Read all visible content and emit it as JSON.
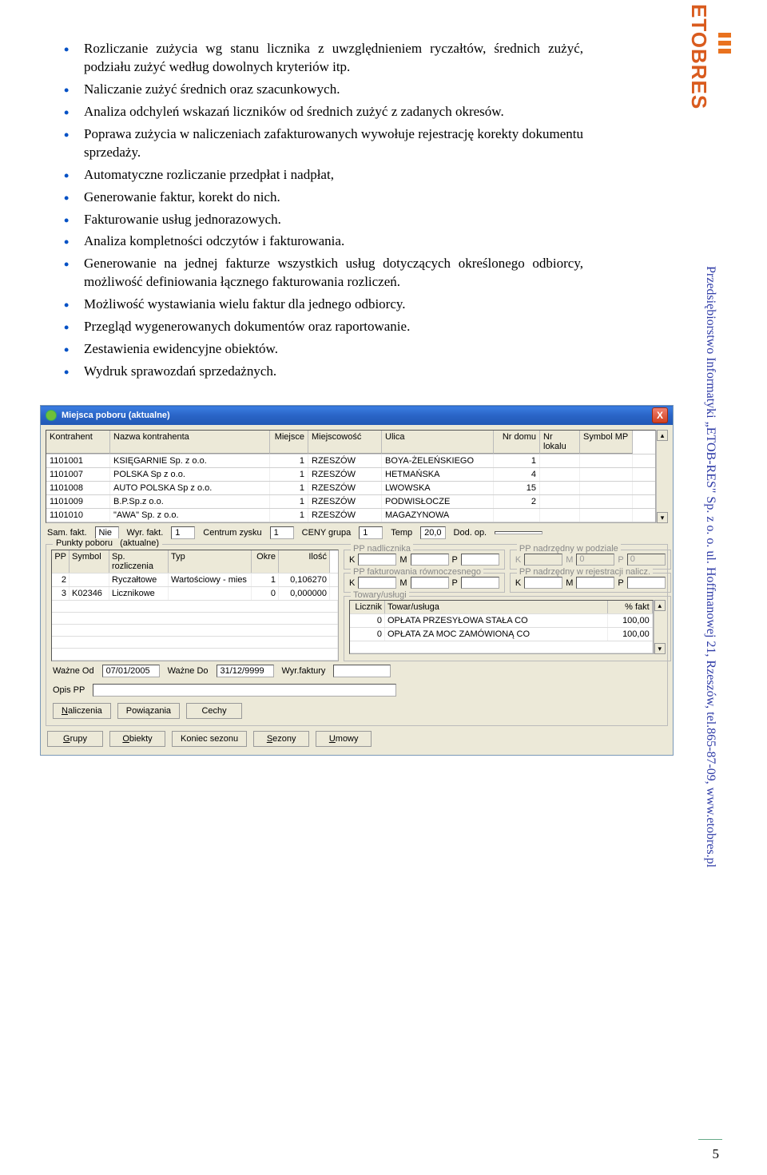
{
  "bullets": [
    "Rozliczanie zużycia wg stanu licznika z uwzględnieniem ryczałtów, średnich zużyć, podziału zużyć według dowolnych kryteriów itp.",
    "Naliczanie zużyć średnich oraz szacunkowych.",
    "Analiza odchyleń wskazań liczników od średnich zużyć z zadanych okresów.",
    "Poprawa zużycia w naliczeniach zafakturowanych wywołuje rejestrację korekty dokumentu sprzedaży.",
    "Automatyczne rozliczanie przedpłat i nadpłat,",
    "Generowanie faktur, korekt do nich.",
    "Fakturowanie usług jednorazowych.",
    "Analiza kompletności odczytów i fakturowania.",
    "Generowanie na jednej fakturze wszystkich usług dotyczących określonego odbiorcy, możliwość definiowania łącznego fakturowania rozliczeń.",
    "Możliwość wystawiania wielu faktur dla jednego odbiorcy.",
    "Przegląd wygenerowanych dokumentów oraz raportowanie.",
    "Zestawienia ewidencyjne obiektów.",
    "Wydruk sprawozdań sprzedażnych."
  ],
  "sidebar": {
    "logo": "ETOBRES",
    "text": "Przedsiębiorstwo Informatyki „ETOB-RES\" Sp. z o. o. ul. Hoffmanowej 21, Rzeszów, tel.865-87-09, www.etobres.pl"
  },
  "dialog": {
    "title": "Miejsca poboru (aktualne)",
    "close": "X",
    "grid": {
      "headers": {
        "kontrahent": "Kontrahent",
        "nazwa": "Nazwa kontrahenta",
        "miejsce": "Miejsce",
        "miejscowosc": "Miejscowość",
        "ulica": "Ulica",
        "nrdomu": "Nr domu",
        "nrlok": "Nr lokalu",
        "sym": "Symbol MP"
      },
      "rows": [
        {
          "kontrahent": "1101001",
          "nazwa": "KSIĘGARNIE Sp. z o.o.",
          "miejsce": "1",
          "miejscowosc": "RZESZÓW",
          "ulica": "BOYA-ŻELEŃSKIEGO",
          "nrdomu": "1",
          "nrlok": "",
          "sym": ""
        },
        {
          "kontrahent": "1101007",
          "nazwa": "POLSKA Sp z o.o.",
          "miejsce": "1",
          "miejscowosc": "RZESZÓW",
          "ulica": "HETMAŃSKA",
          "nrdomu": "4",
          "nrlok": "",
          "sym": ""
        },
        {
          "kontrahent": "1101008",
          "nazwa": "AUTO POLSKA Sp z o.o.",
          "miejsce": "1",
          "miejscowosc": "RZESZÓW",
          "ulica": "LWOWSKA",
          "nrdomu": "15",
          "nrlok": "",
          "sym": ""
        },
        {
          "kontrahent": "1101009",
          "nazwa": "B.P.Sp.z o.o.",
          "miejsce": "1",
          "miejscowosc": "RZESZÓW",
          "ulica": "PODWISŁOCZE",
          "nrdomu": "2",
          "nrlok": "",
          "sym": ""
        },
        {
          "kontrahent": "1101010",
          "nazwa": "\"AWA\" Sp. z o.o.",
          "miejsce": "1",
          "miejscowosc": "RZESZÓW",
          "ulica": "MAGAZYNOWA",
          "nrdomu": "",
          "nrlok": "",
          "sym": ""
        }
      ]
    },
    "info": {
      "samfakt_lbl": "Sam. fakt.",
      "samfakt_val": "Nie",
      "wyrfakt_lbl": "Wyr. fakt.",
      "wyrfakt_val": "1",
      "centrum_lbl": "Centrum zysku",
      "centrum_val": "1",
      "ceny_lbl": "CENY grupa",
      "ceny_val": "1",
      "temp_lbl": "Temp",
      "temp_val": "20,0",
      "dodop_lbl": "Dod. op.",
      "dodop_val": ""
    },
    "punkty": {
      "legend": "Punkty poboru",
      "aktualne": "(aktualne)",
      "headers": {
        "pp": "PP",
        "symbol": "Symbol",
        "sproz": "Sp. rozliczenia",
        "typ": "Typ",
        "okre": "Okre",
        "ilosc": "Ilość"
      },
      "rows": [
        {
          "pp": "2",
          "symbol": "",
          "sproz": "Ryczałtowe",
          "typ": "Wartościowy - mies",
          "okre": "1",
          "ilosc": "0,106270"
        },
        {
          "pp": "3",
          "symbol": "K02346",
          "sproz": "Licznikowe",
          "typ": "",
          "okre": "0",
          "ilosc": "0,000000"
        }
      ]
    },
    "kmp": {
      "nadlicz": "PP nadlicznika",
      "nadpodz": "PP nadrzędny w podziale",
      "faktrow": "PP fakturowania równoczesnego",
      "rejnal": "PP nadrzędny w rejestracji nalicz.",
      "K": "K",
      "M": "M",
      "P": "P",
      "zero": "0"
    },
    "towary": {
      "legend": "Towary/usługi",
      "headers": {
        "lic": "Licznik",
        "tu": "Towar/usługa",
        "fakt": "% fakt"
      },
      "rows": [
        {
          "lic": "0",
          "tu": "OPŁATA PRZESYŁOWA STAŁA CO",
          "fakt": "100,00"
        },
        {
          "lic": "0",
          "tu": "OPŁATA ZA MOC ZAMÓWIONĄ CO",
          "fakt": "100,00"
        }
      ]
    },
    "fields": {
      "wazneod_lbl": "Ważne Od",
      "wazneod_val": "07/01/2005",
      "waznedo_lbl": "Ważne Do",
      "waznedo_val": "31/12/9999",
      "wyrfakt_lbl": "Wyr.faktury",
      "wyrfakt_val": "",
      "opis_lbl": "Opis PP",
      "opis_val": ""
    },
    "buttons1": {
      "naliczenia": "Naliczenia",
      "powiazania": "Powiązania",
      "cechy": "Cechy"
    },
    "buttons2": {
      "grupy": "Grupy",
      "obiekty": "Obiekty",
      "koniec": "Koniec sezonu",
      "sezony": "Sezony",
      "umowy": "Umowy"
    }
  },
  "page_number": "5"
}
